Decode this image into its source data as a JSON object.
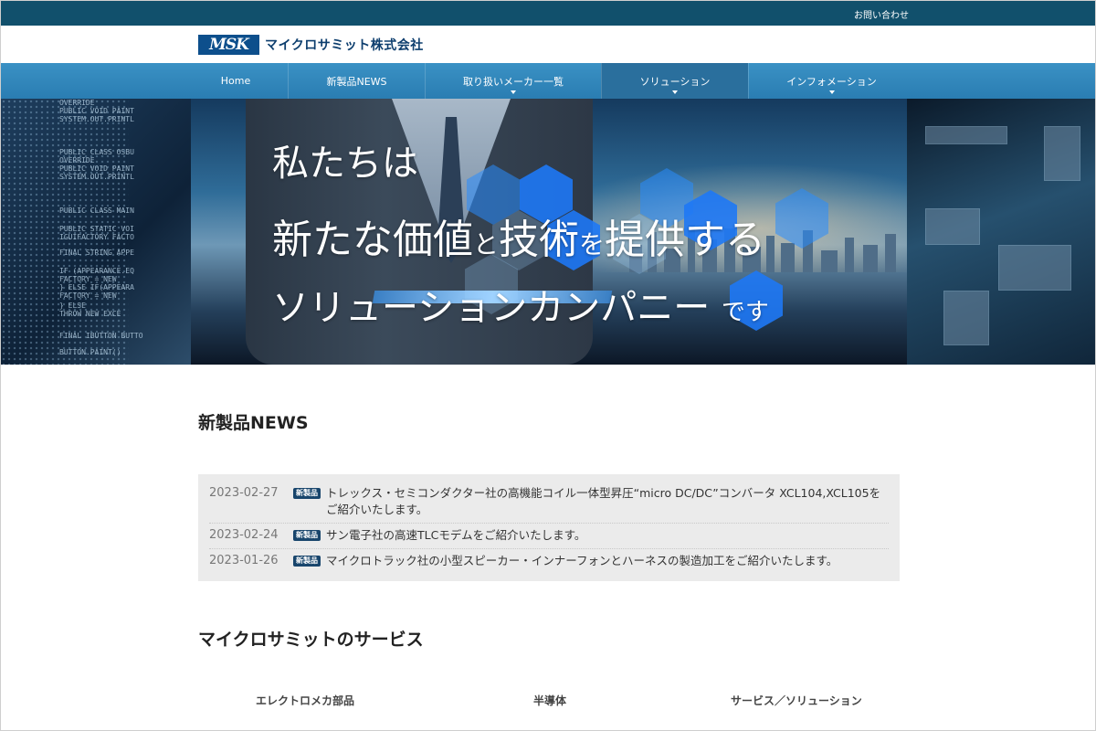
{
  "topbar": {
    "contact_label": "お問い合わせ"
  },
  "header": {
    "logo_mark": "MSK",
    "company_name": "マイクロサミット株式会社"
  },
  "nav": {
    "items": [
      {
        "label": "Home",
        "has_dropdown": false
      },
      {
        "label": "新製品NEWS",
        "has_dropdown": false
      },
      {
        "label": "取り扱いメーカー一覧",
        "has_dropdown": true
      },
      {
        "label": "ソリューション",
        "has_dropdown": true,
        "active": true
      },
      {
        "label": "インフォメーション",
        "has_dropdown": true
      }
    ]
  },
  "hero": {
    "line1": "私たちは",
    "line2": {
      "part1": "新たな価値",
      "part2": "と",
      "part3": "技術",
      "part4": "を",
      "part5": "提供する"
    },
    "line3": {
      "part1": "ソリューションカンパニー",
      "part2": "です"
    },
    "code_lines": [
      "OVERRIDE",
      "PUBLIC VOID PAINT",
      "SYSTEM.OUT.PRINTL",
      "PUBLIC CLASS OSBU",
      "OVERRIDE",
      "PUBLIC VOID PAINT",
      "SYSTEM.OUT.PRINTL",
      "PUBLIC CLASS MAIN",
      "PUBLIC STATIC VOI",
      "IGUIFACTORY FACTO",
      "FINAL STRING APPE",
      "IF (APPEARANCE.EQ",
      "FACTORY = NEW",
      "} ELSE IF(APPEARA",
      "FACTORY = NEW",
      "} ELSE",
      "THROW NEW EXCE",
      "FINAL IBUTTON BUTTO",
      "BUTTON.PAINT()"
    ]
  },
  "news": {
    "title": "新製品NEWS",
    "badge_label": "新製品",
    "items": [
      {
        "date": "2023-02-27",
        "text": "トレックス・セミコンダクター社の高機能コイル一体型昇圧“micro DC/DC”コンバータ XCL104,XCL105をご紹介いたします。"
      },
      {
        "date": "2023-02-24",
        "text": "サン電子社の高速TLCモデムをご紹介いたします。"
      },
      {
        "date": "2023-01-26",
        "text": "マイクロトラック社の小型スピーカー・インナーフォンとハーネスの製造加工をご紹介いたします。"
      }
    ]
  },
  "services": {
    "title": "マイクロサミットのサービス",
    "items": [
      {
        "label": "エレクトロメカ部品"
      },
      {
        "label": "半導体"
      },
      {
        "label": "サービス／ソリューション"
      }
    ]
  },
  "colors": {
    "topbar": "#11506c",
    "nav": "#2a7db2",
    "logo": "#0d4f8c",
    "badge": "#18456c"
  }
}
